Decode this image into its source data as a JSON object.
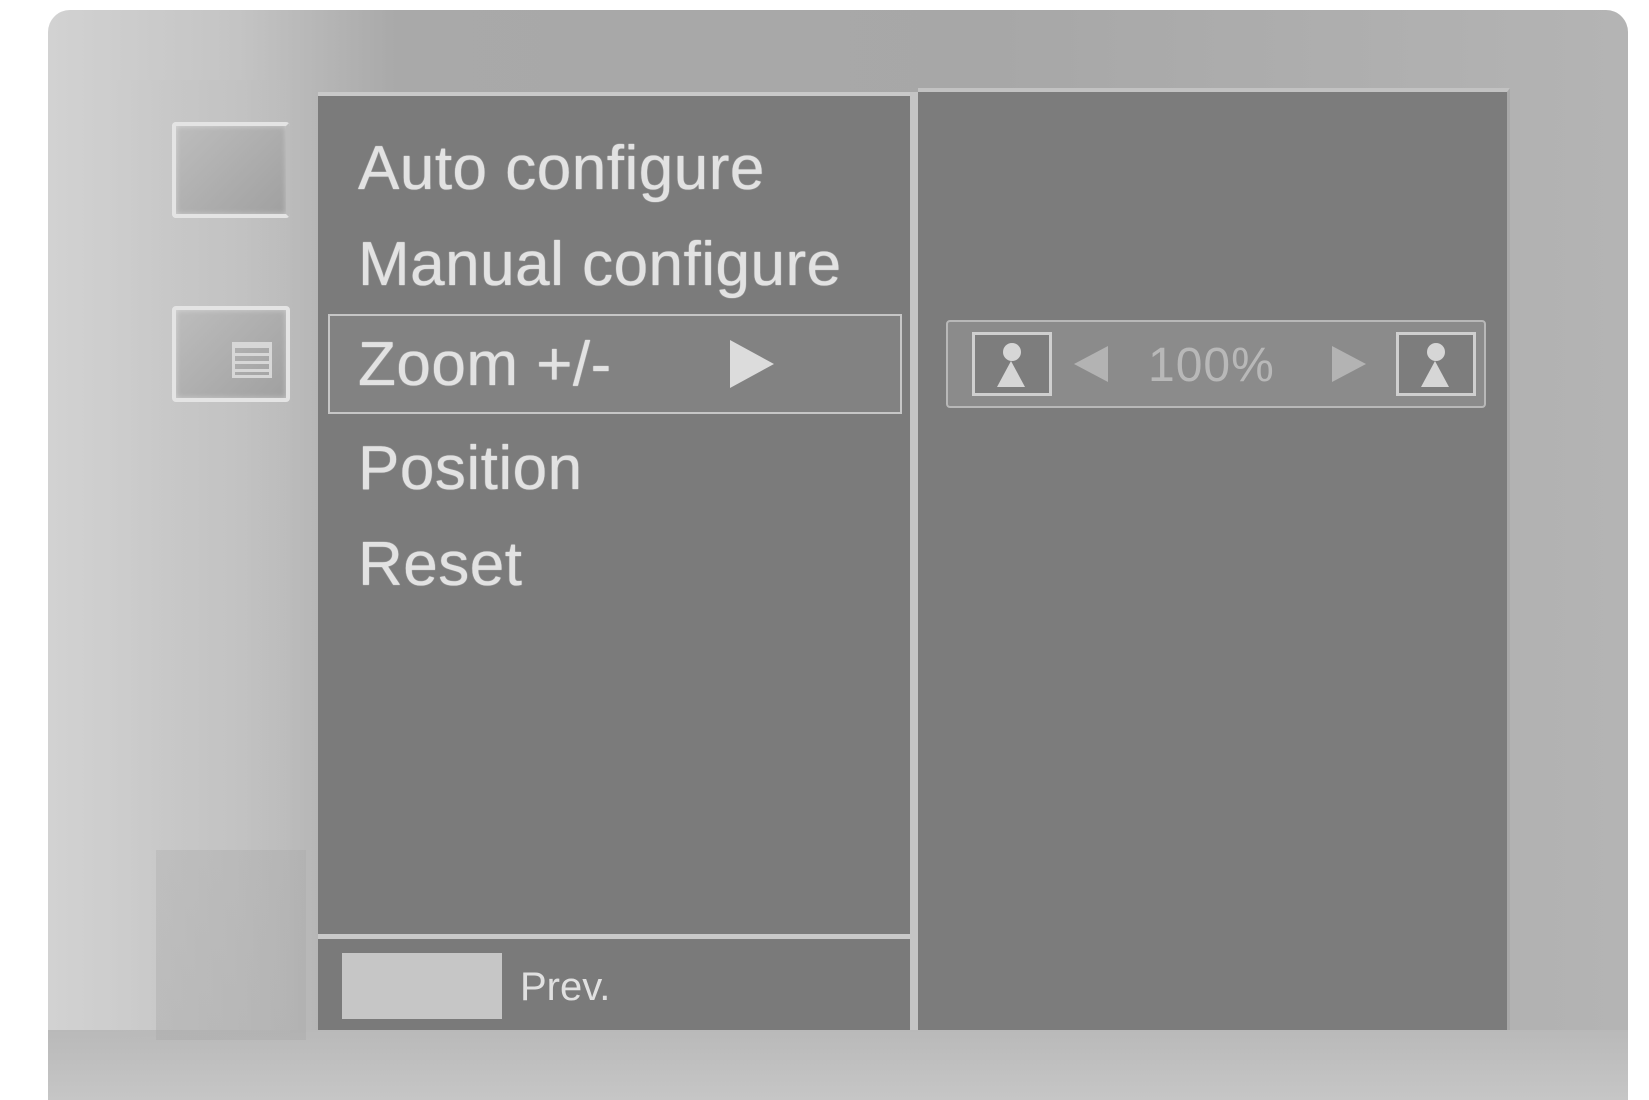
{
  "menu": {
    "items": [
      {
        "label": "Auto configure"
      },
      {
        "label": "Manual configure"
      },
      {
        "label": "Zoom +/-",
        "selected": true
      },
      {
        "label": "Position"
      },
      {
        "label": "Reset"
      }
    ]
  },
  "footer": {
    "prev_label": "Prev."
  },
  "zoom": {
    "value": "100%",
    "left_icon": "person-icon",
    "right_icon": "person-icon"
  },
  "colors": {
    "panel": "#7b7b7b",
    "frame": "#a9a9a9",
    "text": "#e2e2e2"
  }
}
